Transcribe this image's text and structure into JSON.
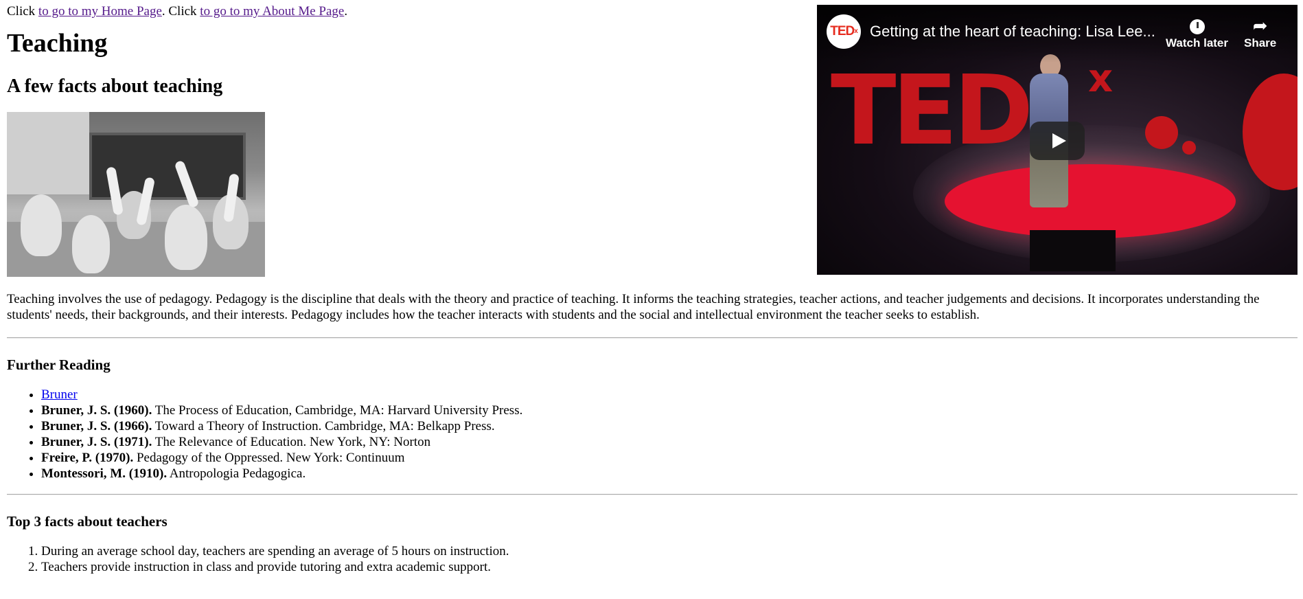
{
  "nav": {
    "click1": "Click ",
    "home_link": "to go to my Home Page",
    "sep": ". Click ",
    "about_link": "to go to my About Me Page",
    "end": "."
  },
  "main": {
    "title": "Teaching",
    "subtitle": "A few facts about teaching",
    "paragraph": "Teaching involves the use of pedagogy. Pedagogy is the discipline that deals with the theory and practice of teaching. It informs the teaching strategies, teacher actions, and teacher judgements and decisions. It incorporates understanding the students' needs, their backgrounds, and their interests. Pedagogy includes how the teacher interacts with students and the social and intellectual environment the teacher seeks to establish."
  },
  "video": {
    "channel": "TED",
    "channel_sup": "x",
    "title": "Getting at the heart of teaching: Lisa Lee...",
    "watch_later": "Watch later",
    "share": "Share",
    "stage_text": "TED",
    "stage_x": "x"
  },
  "further_reading": {
    "heading": "Further Reading",
    "link": "Bruner",
    "items": [
      {
        "author": "Bruner, J. S. (1960).",
        "text": " The Process of Education, Cambridge, MA: Harvard University Press."
      },
      {
        "author": "Bruner, J. S. (1966).",
        "text": " Toward a Theory of Instruction. Cambridge, MA: Belkapp Press."
      },
      {
        "author": "Bruner, J. S. (1971).",
        "text": " The Relevance of Education. New York, NY: Norton"
      },
      {
        "author": "Freire, P. (1970).",
        "text": " Pedagogy of the Oppressed. New York: Continuum"
      },
      {
        "author": "Montessori, M. (1910).",
        "text": " Antropologia Pedagogica."
      }
    ]
  },
  "facts": {
    "heading": "Top 3 facts about teachers",
    "items": [
      "During an average school day, teachers are spending an average of 5 hours on instruction.",
      "Teachers provide instruction in class and provide tutoring and extra academic support."
    ]
  }
}
